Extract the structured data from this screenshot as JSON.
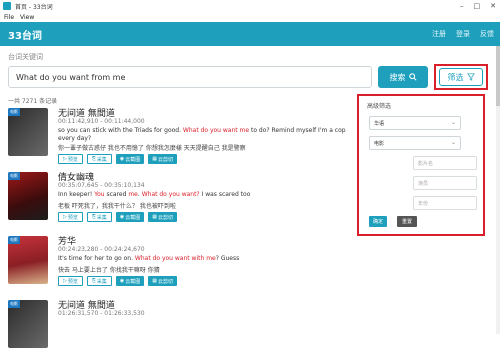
{
  "window": {
    "title": "首页 - 33台词",
    "min": "–",
    "max": "□",
    "close": "✕"
  },
  "menu": [
    "File",
    "View"
  ],
  "nav": {
    "brand": "33台词",
    "links": [
      "注册",
      "登录",
      "反馈"
    ]
  },
  "search": {
    "label": "台词关键词",
    "value": "What do you want from me",
    "button": "搜索",
    "filter": "筛选"
  },
  "count": "一共 7271 条记录",
  "results": [
    {
      "badge": "电影",
      "title": "无间道 無間道",
      "time": "00:11:42,910 - 00:11:44,000",
      "en_parts": [
        "so you can stick with the Triads for good. ",
        "What do you want me",
        " to do? Remind myself I'm a cop every day?"
      ],
      "zh": "你一輩子做古惑仔 我也不用憶了 你想我怎麼樣 天天提醒自己 我是警察",
      "buttons": [
        "预览",
        "采集",
        "云截图",
        "云剪切"
      ]
    },
    {
      "badge": "电影",
      "title": "倩女幽魂",
      "time": "00:35:07,645 - 00:35:10,134",
      "en_parts": [
        "Inn keeper! ",
        "You",
        " scared ",
        "me",
        ". ",
        "What do you want?",
        " I was scared too"
      ],
      "zh": "老板 吓死我了，我我干什么？ 我也被吓到啦",
      "buttons": [
        "预览",
        "采集",
        "云截图",
        "云剪切"
      ]
    },
    {
      "badge": "电影",
      "title": "芳华",
      "time": "00:24:23,280 - 00:24:24,670",
      "en_parts": [
        "It's time for her to go on. ",
        "What do you want with",
        " ",
        "me",
        "? Guess"
      ],
      "zh": "快去 马上要上台了 你找我干嘛呀 你猜",
      "buttons": [
        "预览",
        "采集",
        "云截图",
        "云剪切"
      ]
    },
    {
      "badge": "电影",
      "title": "无间道 無間道",
      "time": "01:26:31,570 - 01:26:33,530",
      "en_parts": [],
      "zh": "",
      "buttons": []
    }
  ],
  "panel": {
    "title": "高级筛选",
    "lang": "华语",
    "type": "电影",
    "ph_name": "影片名",
    "ph_actor": "演员",
    "ph_year": "年份",
    "ok": "确定",
    "reset": "重置"
  },
  "colors": {
    "accent": "#1ea0bd",
    "highlight": "#d9202a",
    "badge": "#1e78c0"
  }
}
